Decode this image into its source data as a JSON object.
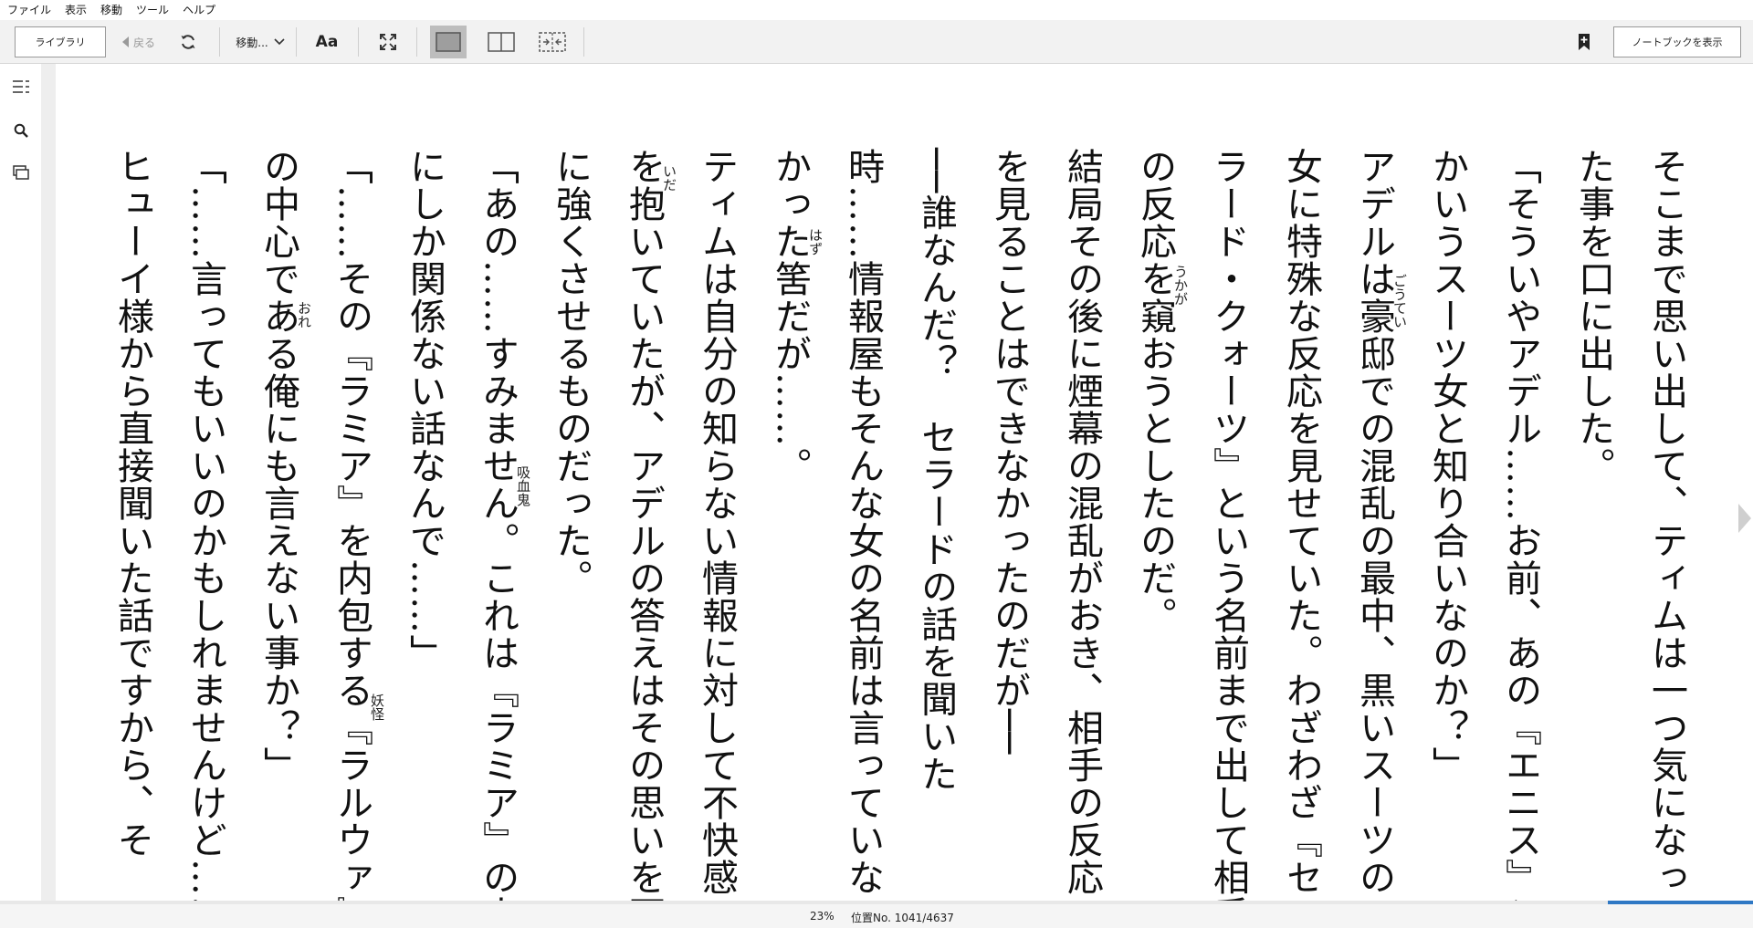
{
  "menu": [
    "ファイル",
    "表示",
    "移動",
    "ツール",
    "ヘルプ"
  ],
  "toolbar": {
    "library_label": "ライブラリ",
    "back_label": "戻る",
    "goto_label": "移動...",
    "font_label": "Aa",
    "notebook_label": "ノートブックを表示"
  },
  "accent_color": "#2f78c4",
  "reading_progress": 0.23,
  "status": {
    "percent": "23%",
    "location": "位置No. 1041/4637"
  },
  "text_lines": [
    "そこまで思い出して、ティムは一つ気になっ",
    "た事を口に出した。",
    "「そういやアデル……お前、あの『エニス』と",
    "かいうスーツ女と知り合いなのか？」",
    "アデルは豪邸での混乱の最中、黒いスーツの",
    "女に特殊な反応を見せていた。わざわざ『セ",
    "ラード・クォーツ』という名前まで出して相手",
    "の反応を窺おうとしたのだ。",
    "結局その後に煙幕の混乱がおき、相手の反応",
    "を見ることはできなかったのだが──",
    "──誰なんだ？　セラードの話を聞いた",
    "時……情報屋もそんな女の名前は言っていな",
    "かった筈だが……。",
    "ティムは自分の知らない情報に対して不快感",
    "を抱いていたが、アデルの答えはその思いを更",
    "に強くさせるものだった。",
    "「あの……すみません。これは『ラミア』の人",
    "にしか関係ない話なんで……」",
    "「……その『ラミア』を内包する『ラルウァ』",
    "の中心である俺にも言えない事か？」",
    "「……言ってもいいのかもしれませんけど……",
    "ヒューイ様から直接聞いた話ですから、そ"
  ],
  "ruby": [
    {
      "text": "ごうてい",
      "line": 4
    },
    {
      "text": "うかが",
      "line": 7
    },
    {
      "text": "はず",
      "line": 12
    },
    {
      "text": "いだ",
      "line": 14
    },
    {
      "text": "吸血鬼",
      "line": 16
    },
    {
      "text": "おれ",
      "line": 19
    },
    {
      "text": "妖怪",
      "line": 18
    }
  ]
}
